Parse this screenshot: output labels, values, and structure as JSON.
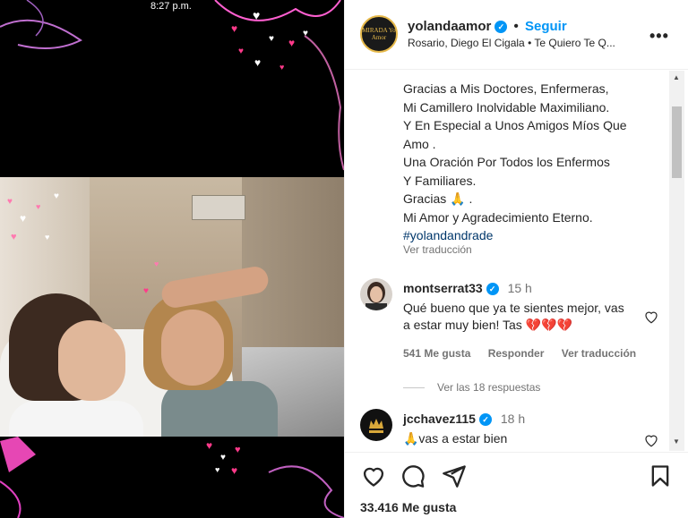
{
  "media": {
    "status_time": "8:27 p.m."
  },
  "header": {
    "avatar_text": "MIRADA Yo Amor",
    "username": "yolandaamor",
    "separator": "•",
    "follow_label": "Seguir",
    "audio": "Rosario, Diego El Cigala • Te Quiero Te Q...",
    "more_label": "•••"
  },
  "caption": {
    "lines": [
      "Gracias a Mis Doctores, Enfermeras,",
      "Mi Camillero Inolvidable Maximiliano.",
      "Y En Especial a Unos Amigos Míos Que",
      "Amo .",
      "Una Oración Por Todos los Enfermos",
      "Y Familiares.",
      "Gracias 🙏 .",
      "Mi Amor y Agradecimiento Eterno."
    ],
    "hashtag": "#yolandandrade",
    "see_translation": "Ver traducción"
  },
  "comments": [
    {
      "user": "montserrat33",
      "time": "15 h",
      "text": "Qué bueno que ya te sientes mejor, vas a estar muy bien! Tas 💔💔💔",
      "likes": "541 Me gusta",
      "reply": "Responder",
      "translate": "Ver traducción",
      "replies": "Ver las 18 respuestas"
    },
    {
      "user": "jcchavez115",
      "time": "18 h",
      "text": "🙏vas a estar bien"
    }
  ],
  "footer": {
    "likes": "33.416 Me gusta"
  },
  "colors": {
    "link_blue": "#0095f6",
    "hashtag": "#00376b",
    "muted": "#737373",
    "verified": "#0095f6"
  },
  "icons": [
    "heart-icon",
    "comment-icon",
    "share-icon",
    "bookmark-icon",
    "verified-icon",
    "more-icon"
  ]
}
